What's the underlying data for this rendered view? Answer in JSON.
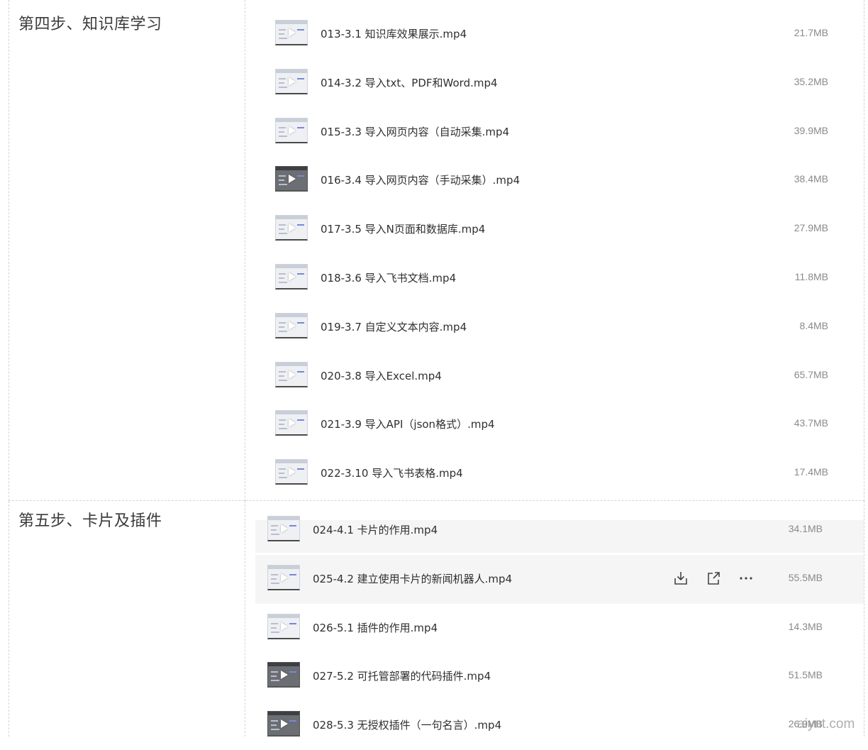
{
  "sections": [
    {
      "title": "第四步、知识库学习",
      "files": [
        {
          "name": "013-3.1 知识库效果展示.mp4",
          "size": "21.7MB"
        },
        {
          "name": "014-3.2 导入txt、PDF和Word.mp4",
          "size": "35.2MB"
        },
        {
          "name": "015-3.3 导入网页内容（自动采集.mp4",
          "size": "39.9MB"
        },
        {
          "name": "016-3.4 导入网页内容（手动采集）.mp4",
          "size": "38.4MB"
        },
        {
          "name": "017-3.5 导入N页面和数据库.mp4",
          "size": "27.9MB"
        },
        {
          "name": "018-3.6 导入飞书文档.mp4",
          "size": "11.8MB"
        },
        {
          "name": "019-3.7 自定义文本内容.mp4",
          "size": "8.4MB"
        },
        {
          "name": "020-3.8 导入Excel.mp4",
          "size": "65.7MB"
        },
        {
          "name": "021-3.9 导入API（json格式）.mp4",
          "size": "43.7MB"
        },
        {
          "name": "022-3.10 导入飞书表格.mp4",
          "size": "17.4MB"
        }
      ]
    },
    {
      "title": "第五步、卡片及插件",
      "files": [
        {
          "name": "024-4.1 卡片的作用.mp4",
          "size": "34.1MB"
        },
        {
          "name": "025-4.2 建立使用卡片的新闻机器人.mp4",
          "size": "55.5MB"
        },
        {
          "name": "026-5.1 插件的作用.mp4",
          "size": "14.3MB"
        },
        {
          "name": "027-5.2 可托管部署的代码插件.mp4",
          "size": "51.5MB"
        },
        {
          "name": "028-5.3 无授权插件（一句名言）.mp4",
          "size": "26.9MB"
        }
      ]
    }
  ],
  "row_actions": {
    "download_icon": "download-icon",
    "share_icon": "share-icon",
    "more_icon": "more-icon"
  },
  "watermark": "aiynt.com",
  "colors": {
    "highlight": "#f5f5f5",
    "text": "#2f2f2f",
    "size_text": "#8a8a8a"
  }
}
